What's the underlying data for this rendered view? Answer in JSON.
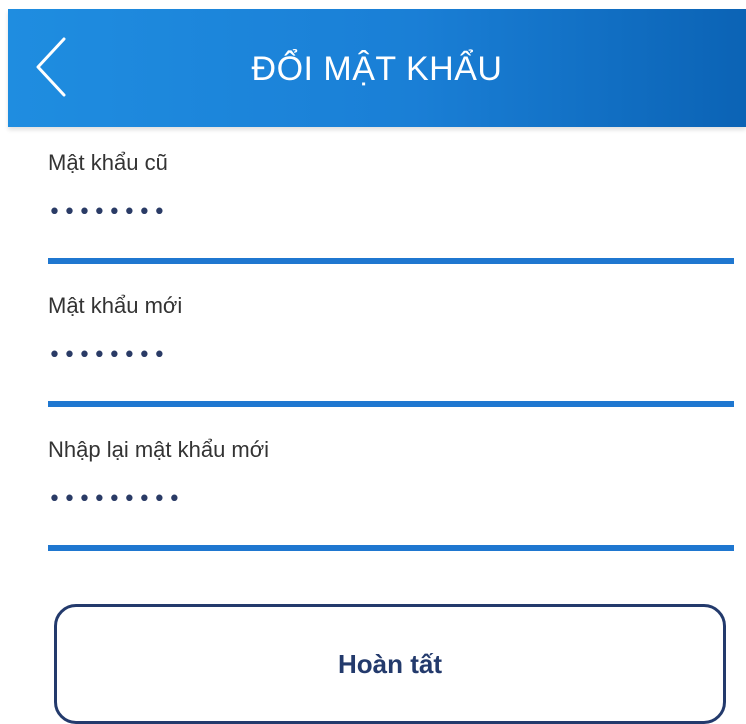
{
  "header": {
    "title": "ĐỔI MẬT KHẨU",
    "back_icon": "chevron-left-icon"
  },
  "form": {
    "fields": [
      {
        "label": "Mật khẩu cũ",
        "value": "••••••••"
      },
      {
        "label": "Mật khẩu mới",
        "value": "••••••••"
      },
      {
        "label": "Nhập lại mật khẩu mới",
        "value": "•••••••••"
      }
    ],
    "submit_label": "Hoàn tất"
  },
  "colors": {
    "header_start": "#1f8de0",
    "header_end": "#0b63b5",
    "underline": "#1f77d0",
    "button_border": "#233a6c",
    "label_text": "#333333"
  }
}
